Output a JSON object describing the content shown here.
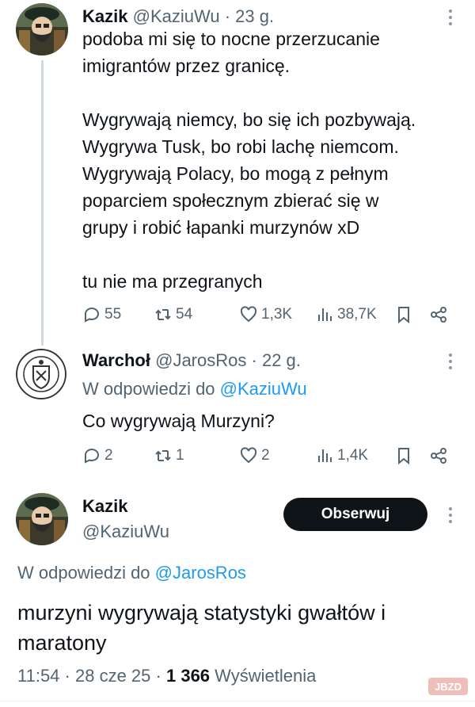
{
  "tweet1": {
    "name": "Kazik",
    "handle": "@KaziuWu",
    "time": "23 g.",
    "text": "podoba mi się to nocne przerzucanie\nimigrantów przez granicę.\n\nWygrywają niemcy, bo się ich pozbywają.\nWygrywa Tusk, bo robi lachę niemcom.\nWygrywają Polacy, bo mogą z pełnym\npoparciem społecznym zbierać się w\ngrupy i robić łapanki murzynów xD\n\ntu nie ma przegranych",
    "replies": "55",
    "reposts": "54",
    "likes": "1,3K",
    "views": "38,7K"
  },
  "tweet2": {
    "name": "Warchoł",
    "handle": "@JarosRos",
    "time": "22 g.",
    "reply_prefix": "W odpowiedzi do",
    "reply_to": "@KaziuWu",
    "text": "Co wygrywają Murzyni?",
    "replies": "2",
    "reposts": "1",
    "likes": "2",
    "views": "1,4K"
  },
  "main": {
    "name": "Kazik",
    "handle": "@KaziuWu",
    "follow_label": "Obserwuj",
    "reply_prefix": "W odpowiedzi do",
    "reply_to": "@JarosRos",
    "text": "murzyni wygrywają statystyki gwałtów i maratony",
    "time": "11:54",
    "date": "28 cze 25",
    "views_count": "1 366",
    "views_label": "Wyświetlenia"
  },
  "watermark": "JBZD",
  "colors": {
    "text": "#0f1419",
    "muted": "#536471",
    "link": "#1d9bf0",
    "thread": "#cfd9de",
    "button": "#0f1419"
  }
}
